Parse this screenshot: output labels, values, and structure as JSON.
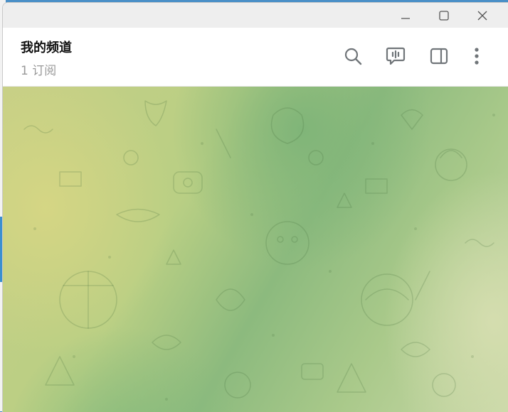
{
  "window": {
    "controls": [
      "minimize",
      "maximize",
      "close"
    ]
  },
  "channel": {
    "title": "我的频道",
    "subscribers": "1 订阅"
  },
  "header_actions": [
    "search-icon",
    "live-stream-icon",
    "side-panel-icon",
    "more-icon"
  ],
  "colors": {
    "header_bg": "#ffffff",
    "titlebar_bg": "#eeeeee",
    "wallpaper_green": "#8cba7e",
    "wallpaper_yellow": "#c6cf86",
    "icon_gray": "#707579"
  }
}
